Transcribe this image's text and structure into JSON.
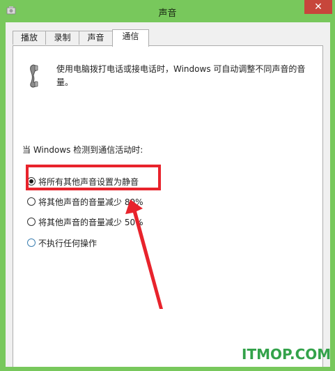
{
  "window": {
    "title": "声音",
    "close_glyph": "✕",
    "frame_color": "#78c85c",
    "close_color": "#c7463b"
  },
  "tabs": [
    {
      "label": "播放",
      "active": false
    },
    {
      "label": "录制",
      "active": false
    },
    {
      "label": "声音",
      "active": false
    },
    {
      "label": "通信",
      "active": true
    }
  ],
  "communications": {
    "description": "使用电脑拨打电话或接电话时，Windows 可自动调整不同声音的音量。",
    "section_label": "当 Windows 检测到通信活动时:",
    "options": [
      {
        "label": "将所有其他声音设置为静音",
        "selected": true
      },
      {
        "label": "将其他声音的音量减少 80%",
        "selected": false
      },
      {
        "label": "将其他声音的音量减少 50%",
        "selected": false
      },
      {
        "label": "不执行任何操作",
        "selected": false
      }
    ]
  },
  "annotation": {
    "highlight_color": "#e8232c",
    "arrow_color": "#e8232c"
  },
  "watermark": {
    "text": "ITMOP.COM",
    "color": "#33a24a"
  },
  "icons": [
    "speaker-app-icon",
    "telephone-handset-icon",
    "close-icon"
  ]
}
